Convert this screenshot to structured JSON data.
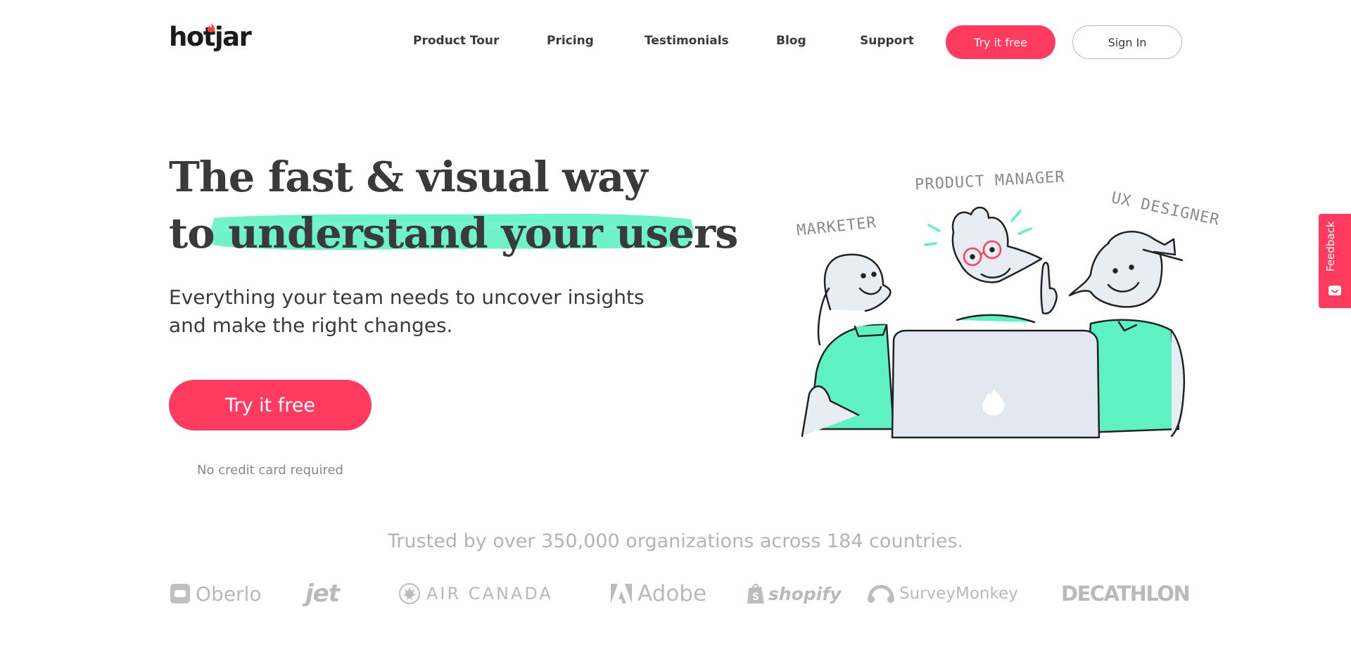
{
  "header": {
    "logo_text": "hotjar",
    "nav": [
      {
        "label": "Product Tour"
      },
      {
        "label": "Pricing"
      },
      {
        "label": "Testimonials"
      },
      {
        "label": "Blog"
      },
      {
        "label": "Support"
      }
    ],
    "try_label": "Try it free",
    "signin_label": "Sign In"
  },
  "hero": {
    "title_line1": "The fast & visual way",
    "title_line2_prefix": "to",
    "title_line2_highlight": "understand your users",
    "subtitle": "Everything your team needs to uncover insights and make the right changes.",
    "cta_label": "Try it free",
    "cta_note": "No credit card required"
  },
  "illustration": {
    "labels": {
      "marketer": "MARKETER",
      "product_manager": "PRODUCT MANAGER",
      "ux_designer": "UX DESIGNER"
    }
  },
  "trusted": {
    "text": "Trusted by over 350,000 organizations across 184 countries.",
    "brands": [
      "Oberlo",
      "jet",
      "AIR CANADA",
      "Adobe",
      "shopify",
      "SurveyMonkey",
      "DECATHLON"
    ]
  },
  "feedback": {
    "label": "Feedback"
  },
  "colors": {
    "accent": "#ff3c5f",
    "highlight": "#5ef2c3",
    "text": "#3a3a3a",
    "muted": "#b3b3b3"
  }
}
